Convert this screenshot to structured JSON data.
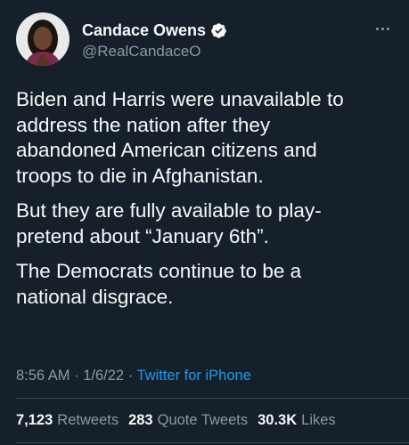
{
  "author": {
    "display_name": "Candace Owens",
    "handle": "@RealCandaceO",
    "verified": true
  },
  "tweet": {
    "paragraphs": [
      "Biden and Harris were unavailable to\naddress the nation after they\nabandoned American citizens and\ntroops to die in Afghanistan.",
      "But they are fully available to play-\npretend about “January 6th”.",
      "The Democrats continue to be a\nnational disgrace."
    ],
    "time": "8:56 AM",
    "separator": "·",
    "date": "1/6/22",
    "source": "Twitter for iPhone"
  },
  "stats": {
    "retweets": {
      "count": "7,123",
      "label": "Retweets"
    },
    "quote_tweets": {
      "count": "283",
      "label": "Quote Tweets"
    },
    "likes": {
      "count": "30.3K",
      "label": "Likes"
    }
  },
  "icons": {
    "verified": "verified-badge-icon",
    "more": "more-options-icon"
  },
  "colors": {
    "background": "#15202b",
    "text": "#f7f9f9",
    "secondary": "#8b98a5",
    "accent": "#1d9bf0"
  }
}
